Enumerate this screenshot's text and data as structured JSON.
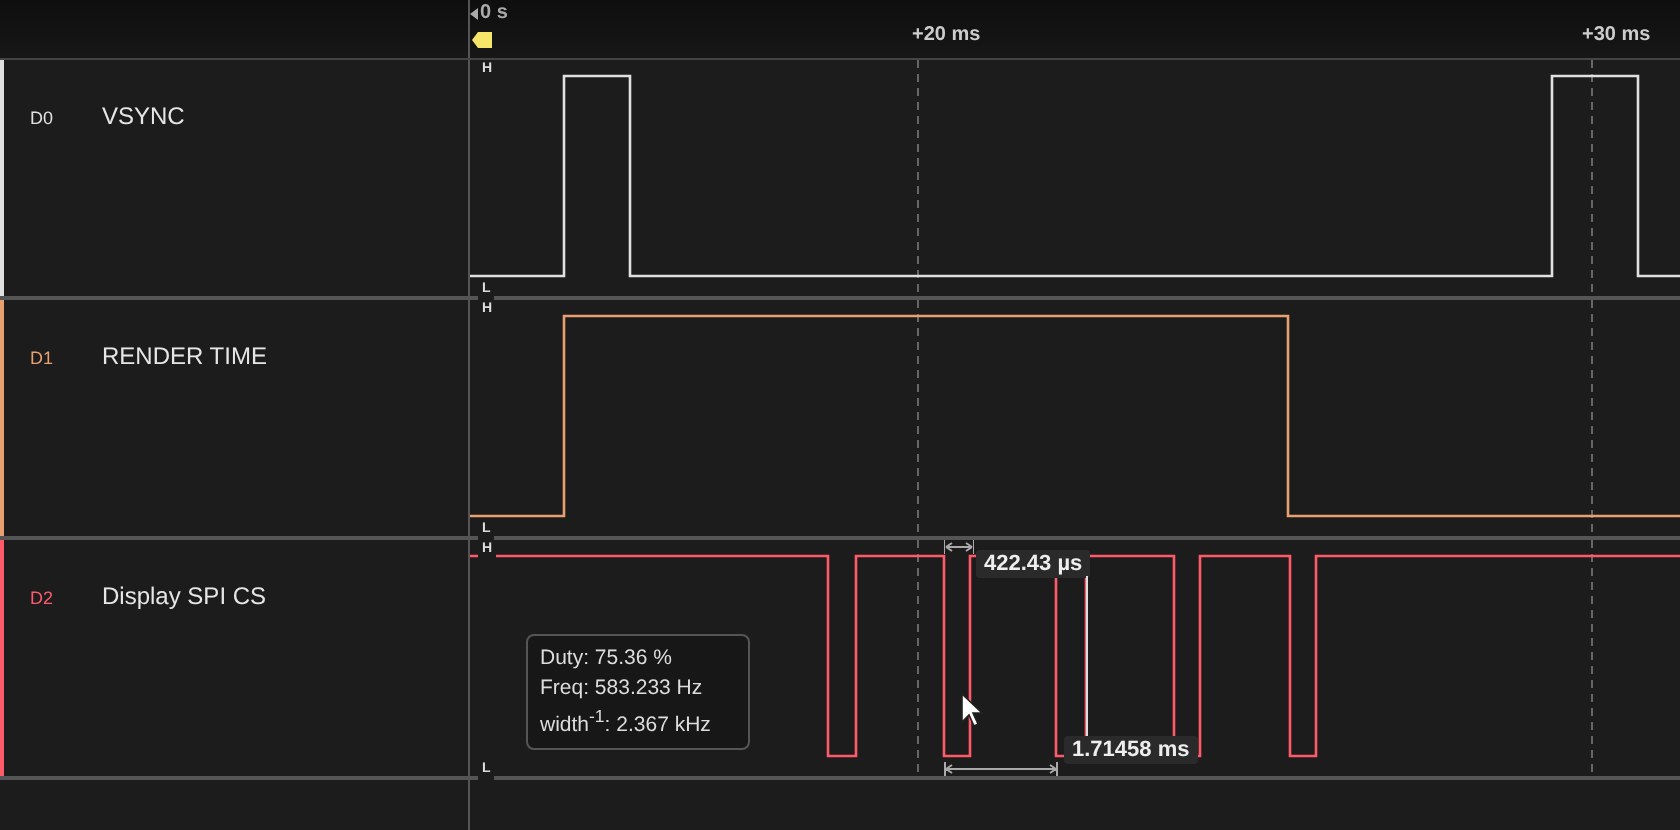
{
  "timeline": {
    "start_label": "0 s",
    "ticks": [
      "+20 ms",
      "+30 ms"
    ]
  },
  "channels": [
    {
      "id": "D0",
      "name": "VSYNC",
      "color": "#e0e0e0",
      "high_label": "H",
      "low_label": "L"
    },
    {
      "id": "D1",
      "name": "RENDER TIME",
      "color": "#e8a070",
      "high_label": "H",
      "low_label": "L"
    },
    {
      "id": "D2",
      "name": "Display SPI CS",
      "color": "#ff5a6a",
      "high_label": "H",
      "low_label": "L"
    }
  ],
  "measurement": {
    "pulse_width": "422.43 µs",
    "period": "1.71458 ms",
    "tooltip": [
      "Duty: 75.36 %",
      "Freq: 583.233 Hz",
      "width$^{-1}$: 2.367 kHz"
    ]
  }
}
